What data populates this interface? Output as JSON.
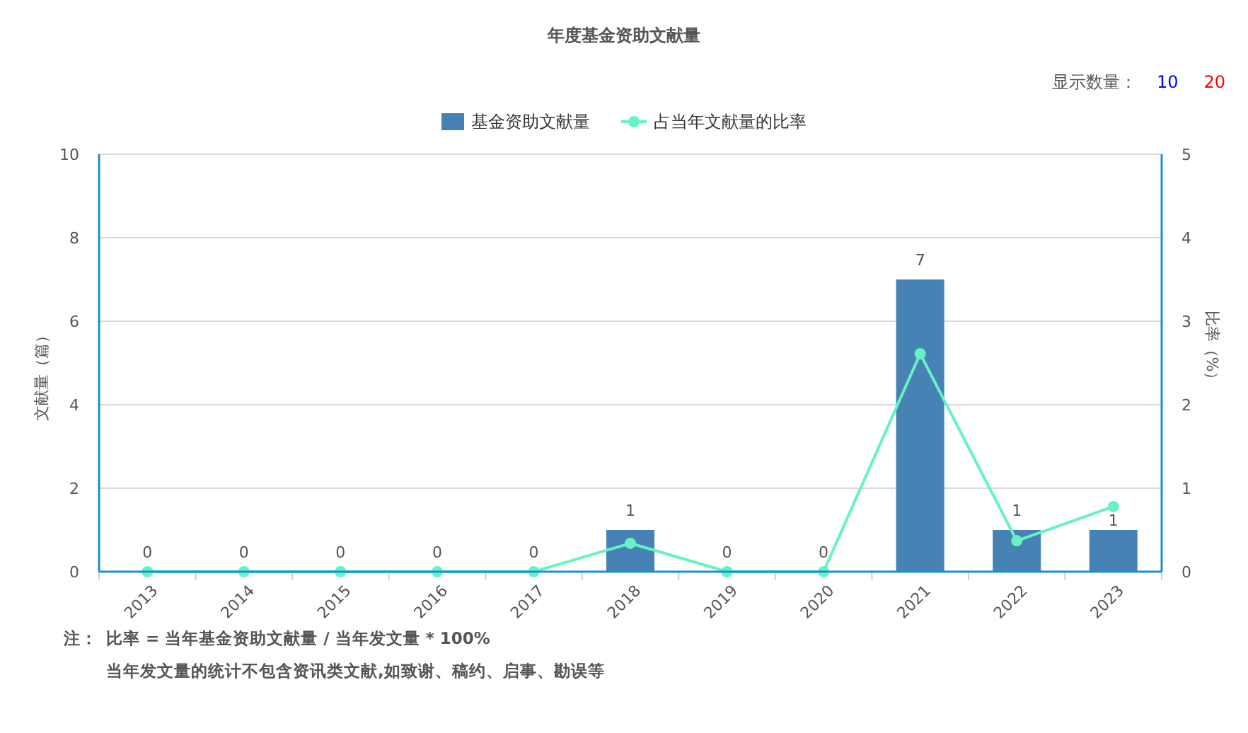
{
  "chart": {
    "title": "年度基金资助文献量",
    "display_count": {
      "label": "显示数量：",
      "options": [
        {
          "label": "10",
          "color": "#0000ff"
        },
        {
          "label": "20",
          "color": "#ff0000"
        }
      ]
    },
    "chart_data": {
      "type": "bar",
      "categories": [
        "2013",
        "2014",
        "2015",
        "2016",
        "2017",
        "2018",
        "2019",
        "2020",
        "2021",
        "2022",
        "2023"
      ],
      "series": [
        {
          "name": "基金资助文献量",
          "color": "#4682b4",
          "values": [
            0,
            0,
            0,
            0,
            0,
            1,
            0,
            0,
            7,
            1,
            1
          ],
          "value_labels": [
            "0",
            "0",
            "0",
            "0",
            "0",
            "1",
            "0",
            "0",
            "7",
            "1",
            "1"
          ]
        },
        {
          "name": "占当年文献量的比率",
          "type": "line",
          "color": "#66f2c2",
          "values": [
            0,
            0,
            0,
            0,
            0,
            0.34,
            0,
            0,
            2.61,
            0.37,
            0.78
          ],
          "axis": "y2",
          "marker": "circle"
        }
      ],
      "ylabel": "文献量（篇）",
      "y2label": "比率（%）",
      "ylim": [
        0,
        10
      ],
      "yticks": [
        0,
        2,
        4,
        6,
        8,
        10
      ],
      "y2lim": [
        0,
        5
      ],
      "y2ticks": [
        0,
        1,
        2,
        3,
        4,
        5
      ],
      "grid": true
    }
  },
  "notes": {
    "label": "注：",
    "lines": [
      "比率 = 当年基金资助文献量 / 当年发文量 * 100%",
      "当年发文量的统计不包含资讯类文献,如致谢、稿约、启事、勘误等"
    ]
  }
}
